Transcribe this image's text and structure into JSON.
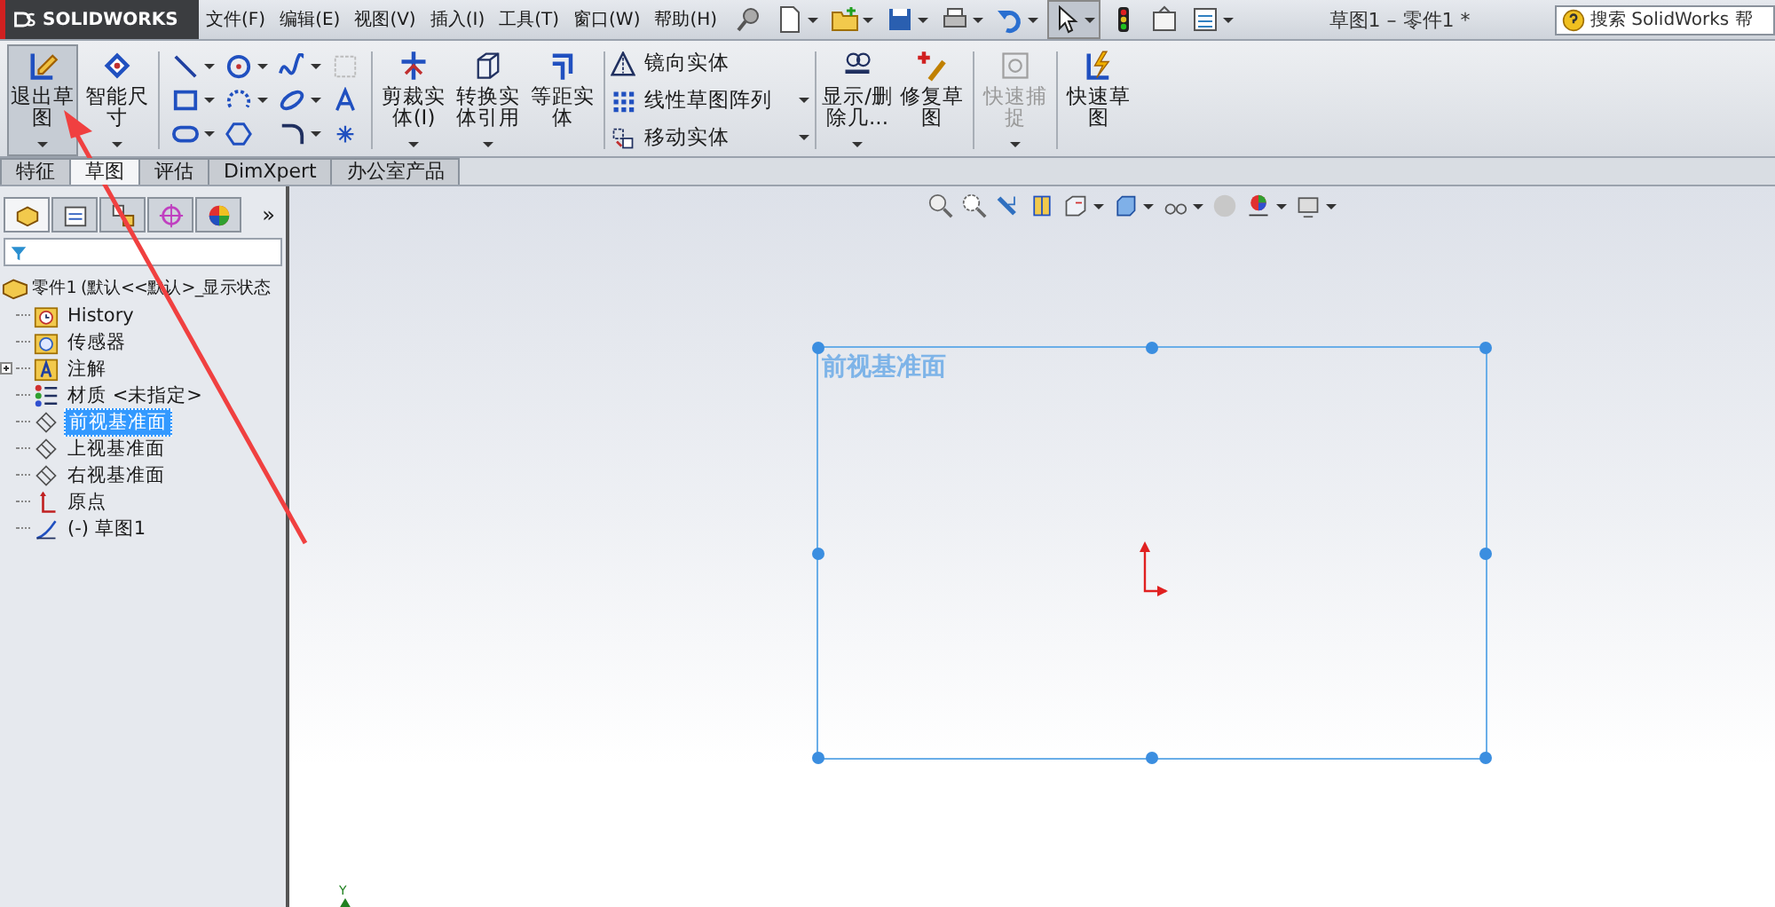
{
  "title_bar": {
    "logo_text": "SOLIDWORKS",
    "menus": [
      "文件(F)",
      "编辑(E)",
      "视图(V)",
      "插入(I)",
      "工具(T)",
      "窗口(W)",
      "帮助(H)"
    ],
    "document_title": "草图1 – 零件1 *",
    "search": {
      "placeholder": "搜索 SolidWorks 帮"
    }
  },
  "ribbon": {
    "groups": [
      {
        "kind": "large",
        "commands": [
          {
            "label": "退出草图",
            "selected": true,
            "disabled": false,
            "dropdown": true
          },
          {
            "label": "智能尺寸",
            "selected": false,
            "disabled": false,
            "dropdown": true
          }
        ]
      },
      {
        "kind": "tool_grid"
      },
      {
        "kind": "large",
        "commands": [
          {
            "label": "剪裁实体(I)",
            "selected": false,
            "disabled": false,
            "dropdown": true
          },
          {
            "label": "转换实体引用",
            "selected": false,
            "disabled": false,
            "dropdown": true
          },
          {
            "label": "等距实体",
            "selected": false,
            "disabled": false,
            "dropdown": false
          }
        ]
      },
      {
        "kind": "small_list",
        "commands": [
          {
            "label": "镜向实体",
            "dropdown": false
          },
          {
            "label": "线性草图阵列",
            "dropdown": true
          },
          {
            "label": "移动实体",
            "dropdown": true
          }
        ]
      },
      {
        "kind": "large",
        "commands": [
          {
            "label": "显示/删除几...",
            "selected": false,
            "disabled": false,
            "dropdown": true
          },
          {
            "label": "修复草图",
            "selected": false,
            "disabled": false,
            "dropdown": false
          }
        ]
      },
      {
        "kind": "large",
        "commands": [
          {
            "label": "快速捕捉",
            "selected": false,
            "disabled": true,
            "dropdown": true
          }
        ]
      },
      {
        "kind": "large",
        "commands": [
          {
            "label": "快速草图",
            "selected": false,
            "disabled": false,
            "dropdown": false
          }
        ]
      }
    ]
  },
  "tabs": [
    {
      "label": "特征",
      "selected": false
    },
    {
      "label": "草图",
      "selected": true
    },
    {
      "label": "评估",
      "selected": false
    },
    {
      "label": "DimXpert",
      "selected": false
    },
    {
      "label": "办公室产品",
      "selected": false
    }
  ],
  "feature_manager": {
    "panel_tabs": [
      {
        "kind": "feature_tree",
        "selected": true
      },
      {
        "kind": "property",
        "selected": false
      },
      {
        "kind": "configuration",
        "selected": false
      },
      {
        "kind": "dimxpert",
        "selected": false
      },
      {
        "kind": "display",
        "selected": false
      }
    ],
    "more_label": "»",
    "tree": {
      "label": "零件1 (默认<<默认>_显示状态",
      "children": [
        {
          "label": "History",
          "kind": "history",
          "collapsible": false,
          "selected": false
        },
        {
          "label": "传感器",
          "kind": "sensors",
          "collapsible": false,
          "selected": false
        },
        {
          "label": "注解",
          "kind": "annotations",
          "collapsible": true,
          "selected": false
        },
        {
          "label": "材质 <未指定>",
          "kind": "material",
          "collapsible": false,
          "selected": false
        },
        {
          "label": "前视基准面",
          "kind": "plane",
          "collapsible": false,
          "selected": true
        },
        {
          "label": "上视基准面",
          "kind": "plane",
          "collapsible": false,
          "selected": false
        },
        {
          "label": "右视基准面",
          "kind": "plane",
          "collapsible": false,
          "selected": false
        },
        {
          "label": "原点",
          "kind": "origin",
          "collapsible": false,
          "selected": false
        },
        {
          "label": "(-) 草图1",
          "kind": "sketch",
          "collapsible": false,
          "selected": false
        }
      ]
    }
  },
  "canvas": {
    "plane_label": "前视基准面",
    "axis_label": "Y"
  }
}
